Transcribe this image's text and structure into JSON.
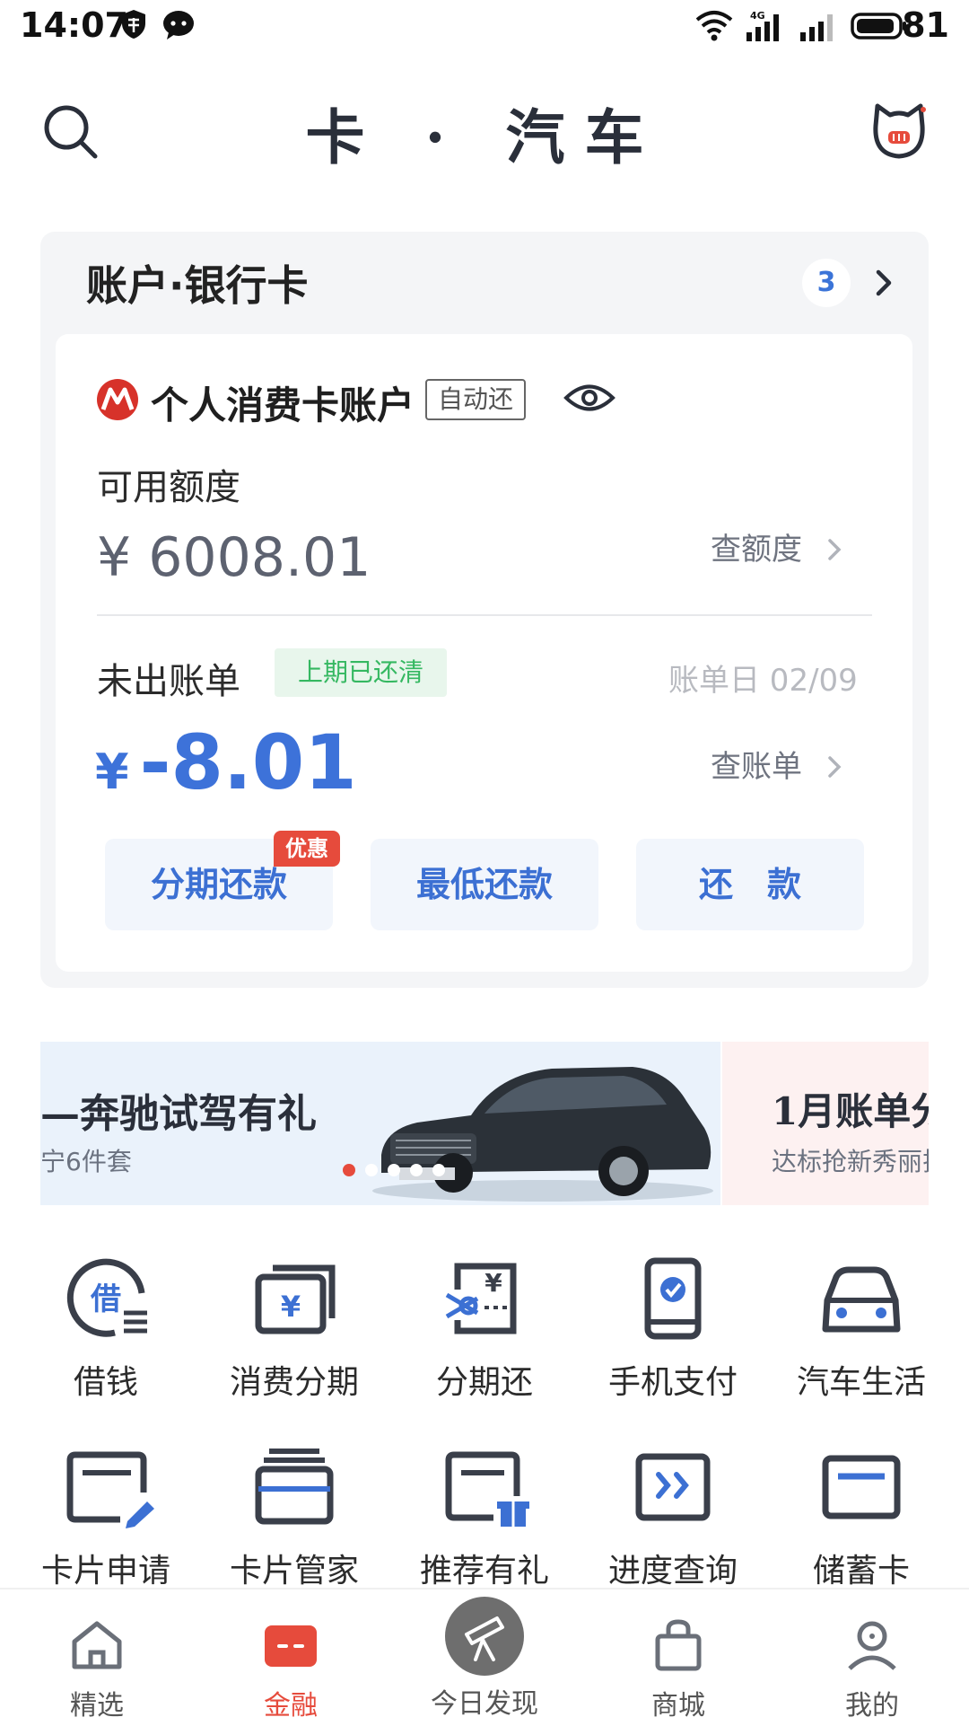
{
  "status_bar": {
    "time": "14:07",
    "battery": "81"
  },
  "header": {
    "title": "卡 · 汽车",
    "search_icon": "search-icon",
    "avatar_icon": "cat-mascot-icon"
  },
  "account": {
    "section_title": "账户·银行卡",
    "card_count": "3",
    "card_name": "个人消费卡账户",
    "auto_repay_badge": "自动还",
    "available_label": "可用额度",
    "available_amount": "¥ 6008.01",
    "check_limit_link": "查额度",
    "unbilled_label": "未出账单",
    "last_period_badge": "上期已还清",
    "bill_date": "账单日 02/09",
    "bill_currency": "¥",
    "bill_amount": "-8.01",
    "check_bill_link": "查账单",
    "installment_repay": "分期还款",
    "discount_tag": "优惠",
    "min_repay": "最低还款",
    "repay": "还　款"
  },
  "banners": [
    {
      "title": "—奔驰试驾有礼",
      "subtitle": "宁6件套"
    },
    {
      "title": "1月账单分",
      "subtitle": "达标抢新秀丽拉"
    }
  ],
  "services_row1": [
    {
      "label": "借钱",
      "icon": "borrow-icon"
    },
    {
      "label": "消费分期",
      "icon": "installment-icon"
    },
    {
      "label": "分期还",
      "icon": "installment-repay-icon"
    },
    {
      "label": "手机支付",
      "icon": "phone-pay-icon"
    },
    {
      "label": "汽车生活",
      "icon": "car-icon"
    }
  ],
  "services_row2": [
    {
      "label": "卡片申请",
      "icon": "card-apply-icon"
    },
    {
      "label": "卡片管家",
      "icon": "card-manager-icon"
    },
    {
      "label": "推荐有礼",
      "icon": "referral-gift-icon"
    },
    {
      "label": "进度查询",
      "icon": "progress-query-icon"
    },
    {
      "label": "储蓄卡",
      "icon": "debit-card-icon"
    }
  ],
  "tabs": [
    {
      "label": "精选",
      "icon": "home-icon"
    },
    {
      "label": "金融",
      "icon": "finance-icon"
    },
    {
      "label": "今日发现",
      "icon": "telescope-icon"
    },
    {
      "label": "商城",
      "icon": "shopping-bag-icon"
    },
    {
      "label": "我的",
      "icon": "profile-icon"
    }
  ],
  "colors": {
    "accent_blue": "#3c70d3",
    "brand_red": "#e64b3c",
    "success_green": "#35b861"
  }
}
